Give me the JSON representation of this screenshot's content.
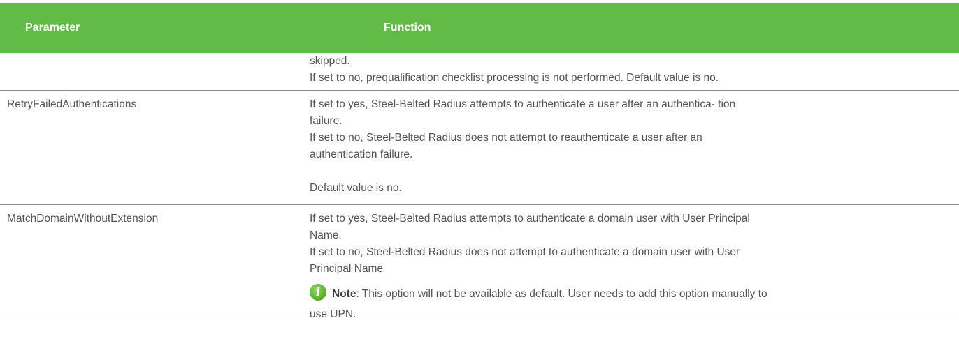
{
  "header": {
    "parameter": "Parameter",
    "function": "Function"
  },
  "rows": [
    {
      "parameter": "",
      "lines": [
        "skipped.",
        "If set to no, prequalification checklist processing is not performed. Default value is no."
      ]
    },
    {
      "parameter": "RetryFailedAuthentications",
      "lines": [
        "If set to yes, Steel-Belted Radius attempts to authenticate a user after an authentica- tion",
        "failure.",
        "If set to no, Steel-Belted Radius does not attempt to reauthenticate a user after an",
        "authentication failure.",
        "Default value is no."
      ]
    },
    {
      "parameter": "MatchDomainWithoutExtension",
      "lines": [
        "If set to yes, Steel-Belted Radius attempts to authenticate a domain user with User Principal",
        "Name.",
        "If set to no, Steel-Belted Radius does not attempt to authenticate a domain user with User",
        "Principal Name"
      ],
      "note": {
        "icon": "info-icon",
        "icon_glyph": "i",
        "label": "Note",
        "text_line1": ": This option will not be available as default. User needs to add this option manually to",
        "text_line2": "use UPN."
      }
    }
  ],
  "colors": {
    "header_bg": "#62bb46",
    "header_text": "#ffffff",
    "body_text": "#555555",
    "rule": "#8a8a8a"
  }
}
